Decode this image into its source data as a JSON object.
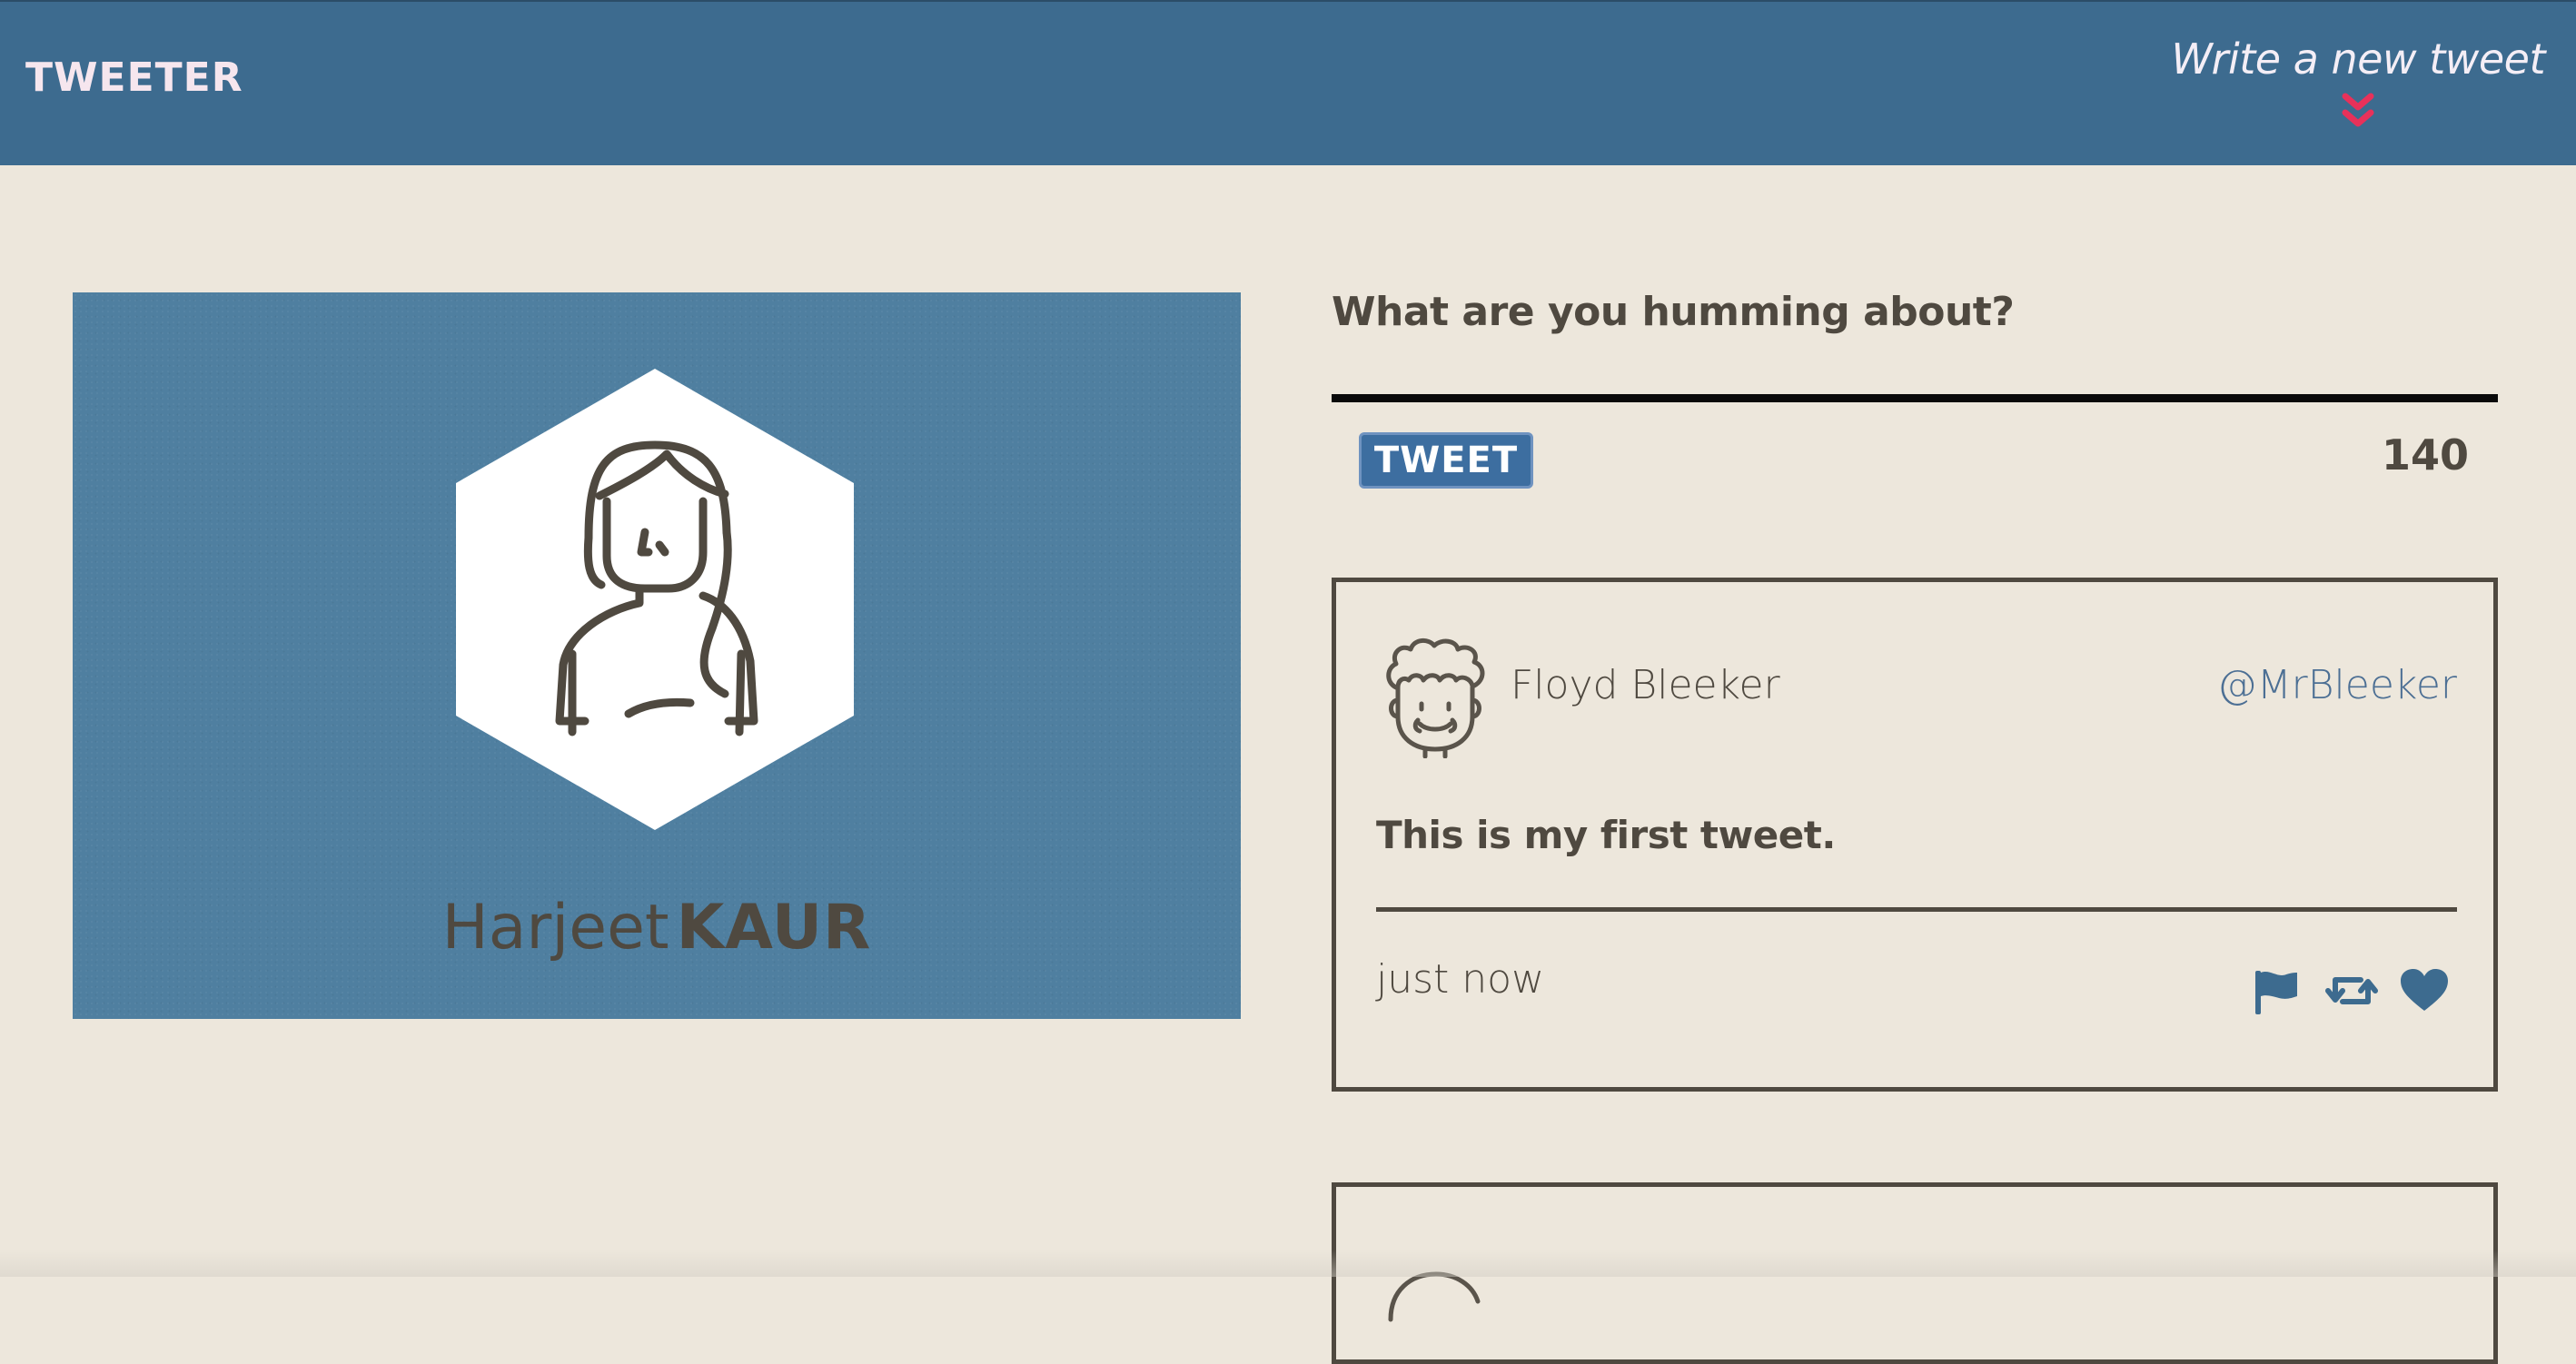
{
  "nav": {
    "brand": "TWEETER",
    "compose_label": "Write a new tweet",
    "compose_icon": "double-chevron-down-icon",
    "accent": "#e8315a",
    "bar_color": "#3d6b8f"
  },
  "profile": {
    "first_name": "Harjeet",
    "last_name": "KAUR",
    "avatar_icon": "woman-avatar-icon",
    "card_color": "#4f7fa0"
  },
  "composer": {
    "prompt": "What are you humming about?",
    "button_label": "TWEET",
    "char_count": "140"
  },
  "tweets": [
    {
      "name": "Floyd Bleeker",
      "handle": "@MrBleeker",
      "text": "This is my first tweet.",
      "time": "just now",
      "avatar_icon": "curly-hair-man-avatar-icon",
      "actions": [
        "flag-icon",
        "retweet-icon",
        "heart-icon"
      ]
    }
  ]
}
